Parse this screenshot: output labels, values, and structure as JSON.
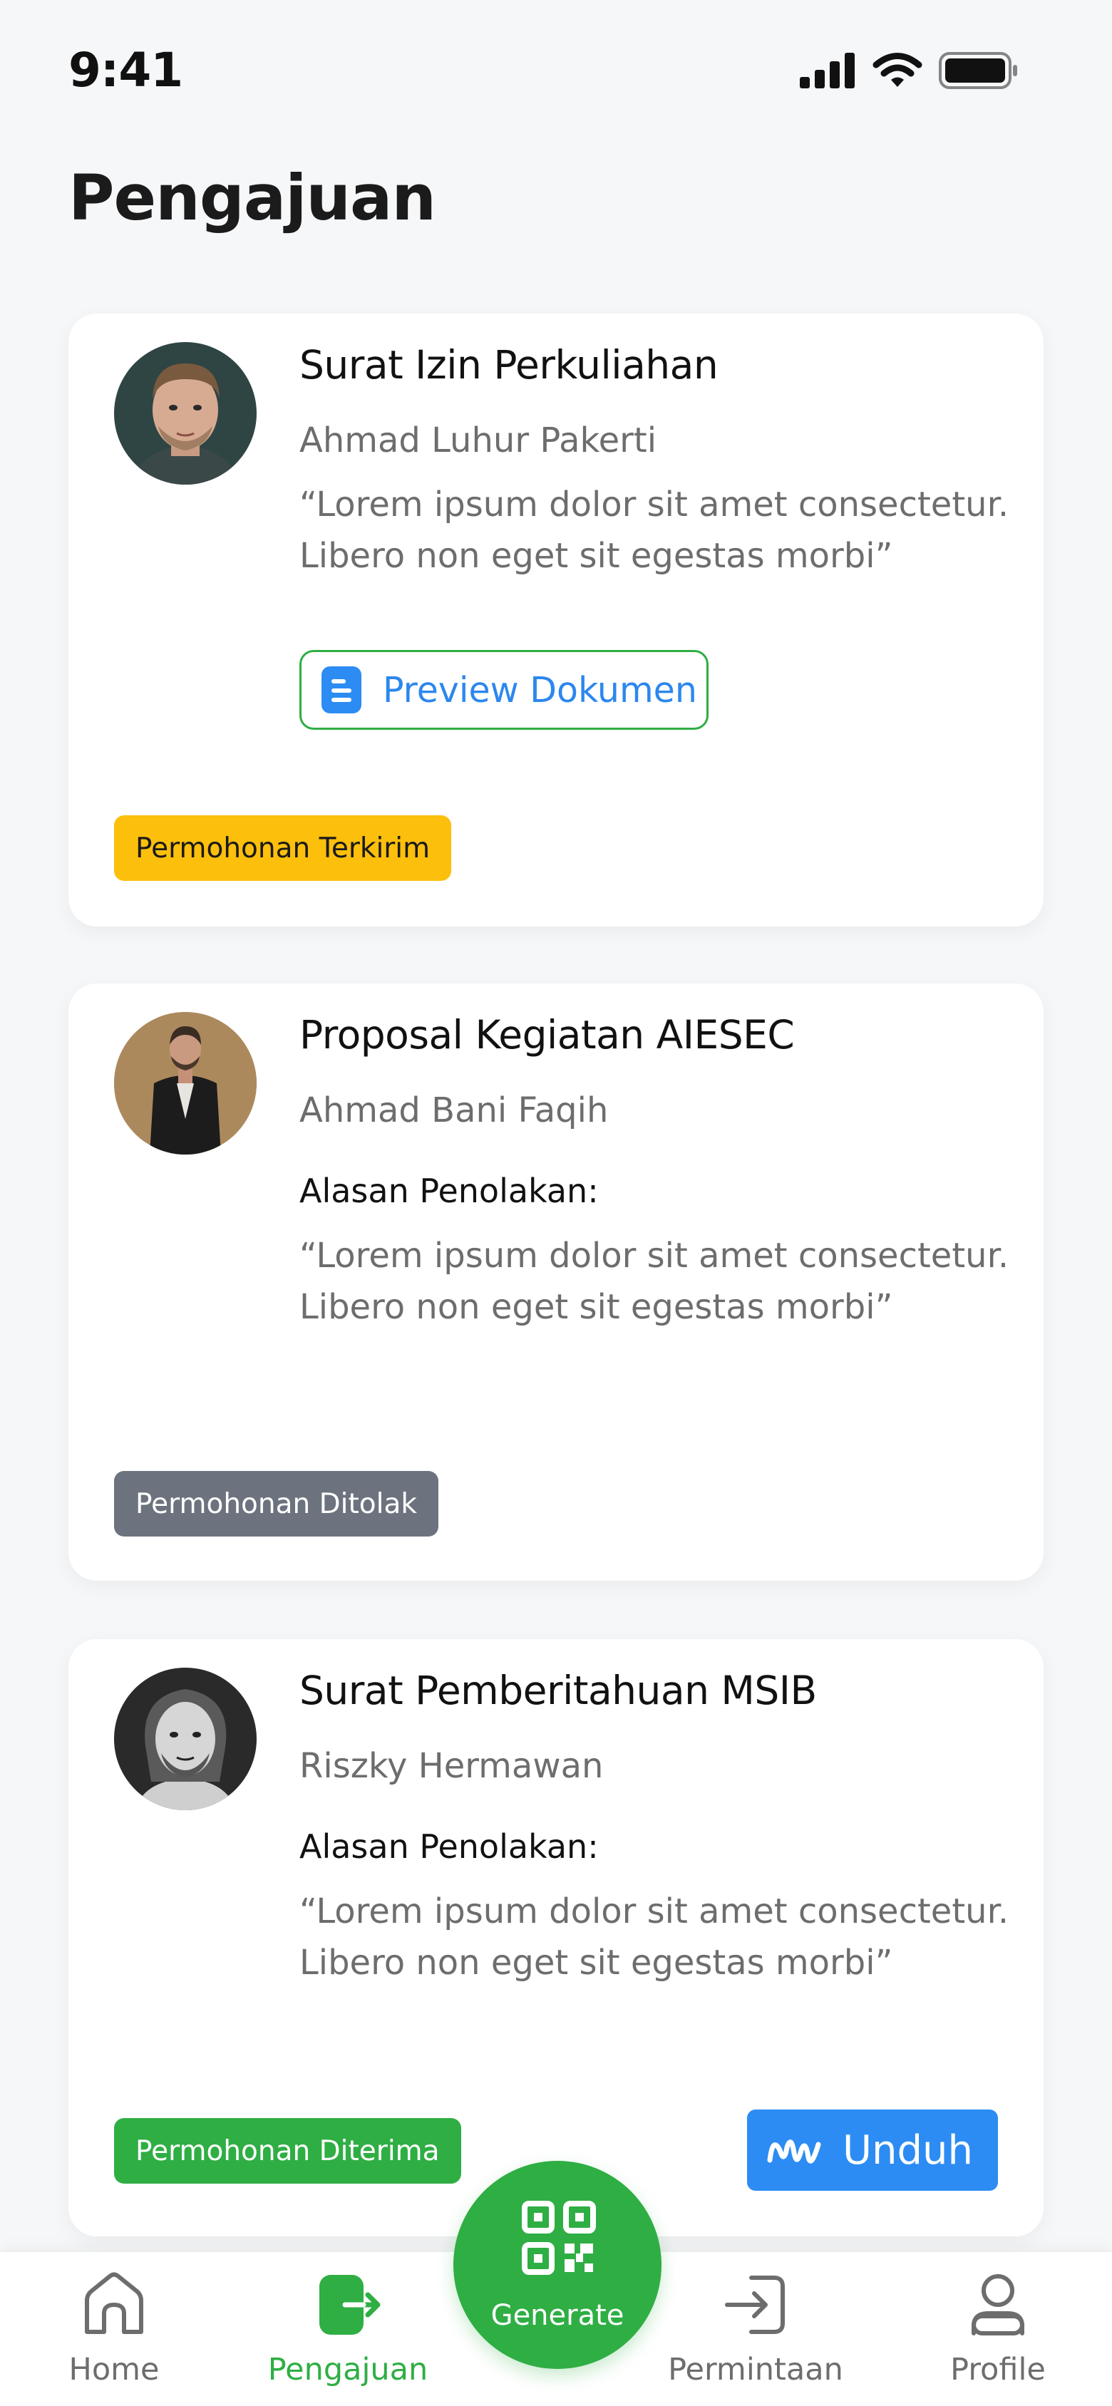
{
  "status_bar": {
    "time": "9:41"
  },
  "page": {
    "title": "Pengajuan"
  },
  "cards": [
    {
      "title": "Surat Izin Perkuliahan",
      "author": "Ahmad Luhur Pakerti",
      "quote": "“Lorem ipsum dolor sit amet consectetur. Libero non eget sit egestas morbi”",
      "preview_label": "Preview Dokumen",
      "status": "Permohonan Terkirim",
      "status_color": "#FCBF0B"
    },
    {
      "title": "Proposal Kegiatan AIESEC",
      "author": "Ahmad Bani Faqih",
      "reason_label": "Alasan Penolakan:",
      "quote": "“Lorem ipsum dolor sit amet consectetur. Libero non eget sit egestas morbi”",
      "status": "Permohonan Ditolak",
      "status_color": "#6C737E"
    },
    {
      "title": "Surat Pemberitahuan MSIB",
      "author": "Riszky Hermawan",
      "reason_label": "Alasan Penolakan:",
      "quote": "“Lorem ipsum dolor sit amet consectetur. Libero non eget sit egestas morbi”",
      "status": "Permohonan Diterima",
      "status_color": "#2FAE44",
      "download_label": "Unduh"
    }
  ],
  "nav": {
    "items": [
      {
        "label": "Home",
        "icon": "home-icon"
      },
      {
        "label": "Pengajuan",
        "icon": "submit-icon",
        "active": true
      },
      {
        "label": "Permintaan",
        "icon": "login-icon"
      },
      {
        "label": "Profile",
        "icon": "user-icon"
      }
    ],
    "fab": {
      "label": "Generate",
      "icon": "qr-code-icon"
    }
  },
  "colors": {
    "primary_green": "#2FAE44",
    "accent_blue": "#2C8CF3",
    "warning_yellow": "#FCBF0B",
    "muted_gray": "#6C737E"
  }
}
